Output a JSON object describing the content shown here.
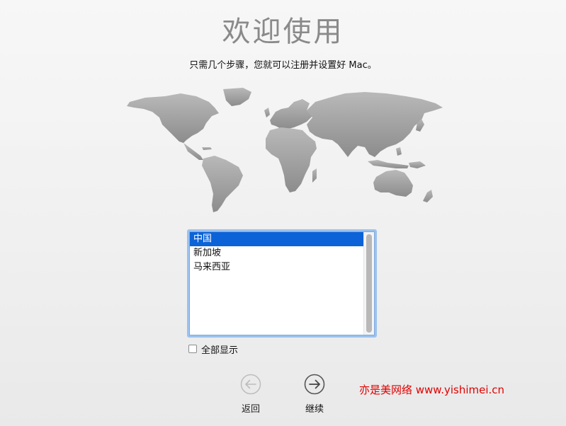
{
  "welcome": {
    "title": "欢迎使用",
    "subtitle": "只需几个步骤，您就可以注册并设置好 Mac。"
  },
  "region_list": {
    "items": [
      {
        "label": "中国",
        "selected": true
      },
      {
        "label": "新加坡",
        "selected": false
      },
      {
        "label": "马来西亚",
        "selected": false
      }
    ],
    "selection_color": "#0b63d7"
  },
  "show_all": {
    "label": "全部显示",
    "checked": false
  },
  "navigation": {
    "back_label": "返回",
    "back_icon": "left-arrow-circle-icon",
    "continue_label": "继续",
    "continue_icon": "right-arrow-circle-icon"
  },
  "watermark": {
    "text": "亦是美网络 www.yishimei.cn",
    "color": "#e00000"
  }
}
